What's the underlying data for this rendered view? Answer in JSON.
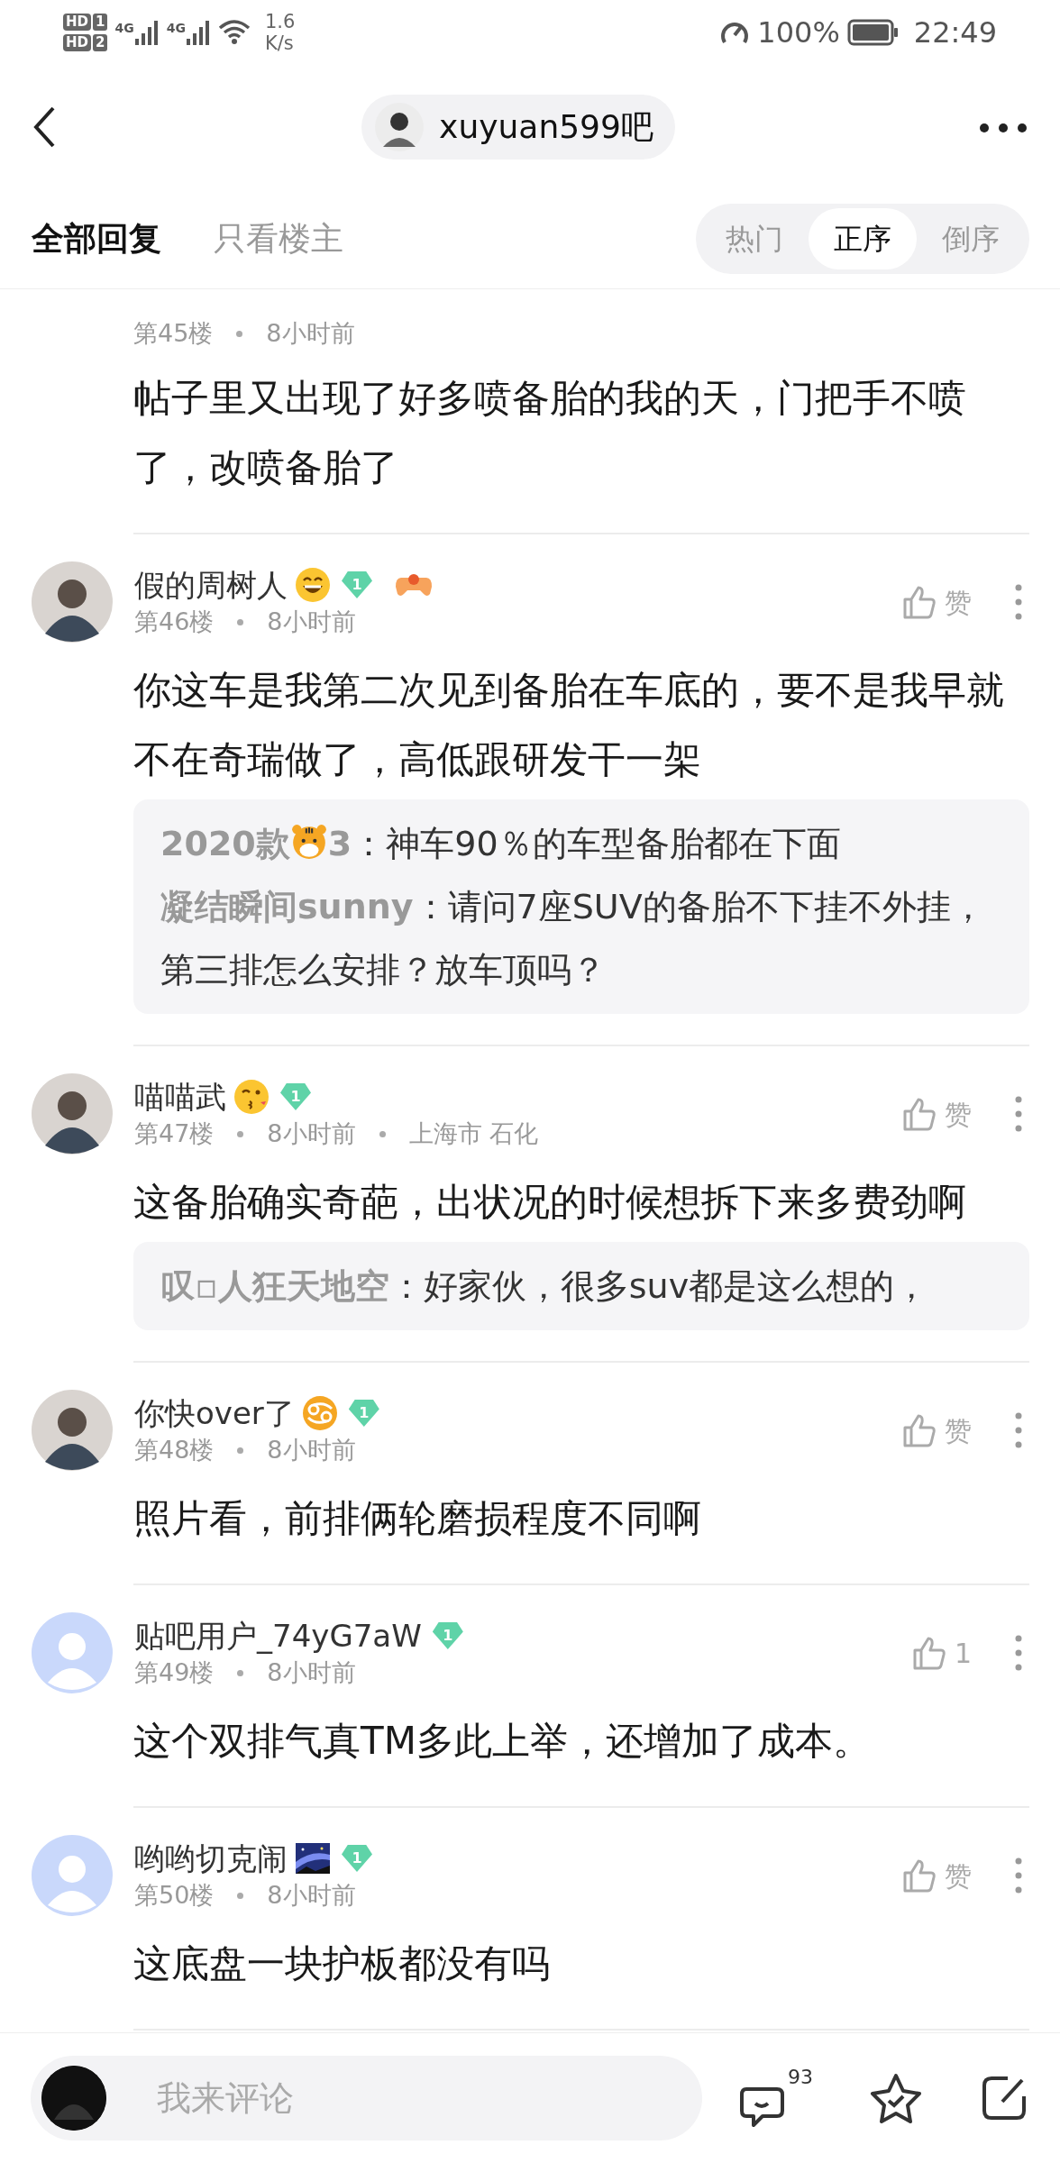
{
  "status_bar": {
    "sim_labels": [
      "HD",
      "HD"
    ],
    "sim_numbers": [
      "1",
      "2"
    ],
    "network": [
      "4G",
      "4G"
    ],
    "speed_value": "1.6",
    "speed_unit": "K/s",
    "battery": "100%",
    "time": "22:49"
  },
  "header": {
    "forum": "xuyuan599吧"
  },
  "filter_tabs": [
    {
      "label": "全部回复",
      "selected": true
    },
    {
      "label": "只看楼主",
      "selected": false
    }
  ],
  "sort_options": [
    {
      "label": "热门",
      "selected": false
    },
    {
      "label": "正序",
      "selected": true
    },
    {
      "label": "倒序",
      "selected": false
    }
  ],
  "posts": [
    {
      "floor": "第45楼",
      "time": "8小时前",
      "body": "帖子里又出现了好多喷备胎的我的天，门把手不喷了，改喷备胎了"
    },
    {
      "author": "假的周树人",
      "avatar": {
        "kind": "photo"
      },
      "badges": [
        {
          "kind": "grin"
        },
        {
          "kind": "level",
          "text": "1"
        },
        {
          "kind": "gamepad"
        }
      ],
      "floor": "第46楼",
      "time": "8小时前",
      "like": "赞",
      "body": "你这车是我第二次见到备胎在车底的，要不是我早就不在奇瑞做了，高低跟研发干一架",
      "replies": [
        {
          "author": "2020款",
          "author_icon": {
            "kind": "tiger"
          },
          "author_suffix": "3",
          "text": "：神车90％的车型备胎都在下面"
        },
        {
          "text": "**凝结瞬间sunny**：请问7座SUV的备胎不下挂不外挂，第三排怎么安排？放车顶吗？"
        }
      ]
    },
    {
      "author": "喵喵武",
      "avatar": {
        "kind": "photo"
      },
      "badges": [
        {
          "kind": "kiss"
        },
        {
          "kind": "level",
          "text": "1"
        }
      ],
      "floor": "第47楼",
      "time": "8小时前",
      "location": "上海市 石化",
      "like": "赞",
      "body": "这备胎确实奇葩，出状况的时候想拆下来多费劲啊",
      "replies": [
        {
          "text": "**叹▫人狂天地空**：好家伙，很多suv都是这么想的，"
        }
      ]
    },
    {
      "author": "你快over了",
      "avatar": {
        "kind": "photo"
      },
      "badges": [
        {
          "kind": "cancer"
        },
        {
          "kind": "level",
          "text": "1"
        }
      ],
      "floor": "第48楼",
      "time": "8小时前",
      "like": "赞",
      "body": "照片看，前排俩轮磨损程度不同啊"
    },
    {
      "author": "贴吧用户_74yG7aW",
      "avatar": {
        "kind": "default"
      },
      "badges": [
        {
          "kind": "level",
          "text": "1"
        }
      ],
      "floor": "第49楼",
      "time": "8小时前",
      "like": "1",
      "body": "这个双排气真TM多此上举，还增加了成本。"
    },
    {
      "author": "哟哟切克闹",
      "avatar": {
        "kind": "default"
      },
      "badges": [
        {
          "kind": "galaxy"
        },
        {
          "kind": "level",
          "text": "1"
        }
      ],
      "floor": "第50楼",
      "time": "8小时前",
      "like": "赞",
      "body": "这底盘一块护板都没有吗"
    }
  ],
  "comment_bar": {
    "placeholder": "我来评论",
    "comment_count": "93"
  }
}
